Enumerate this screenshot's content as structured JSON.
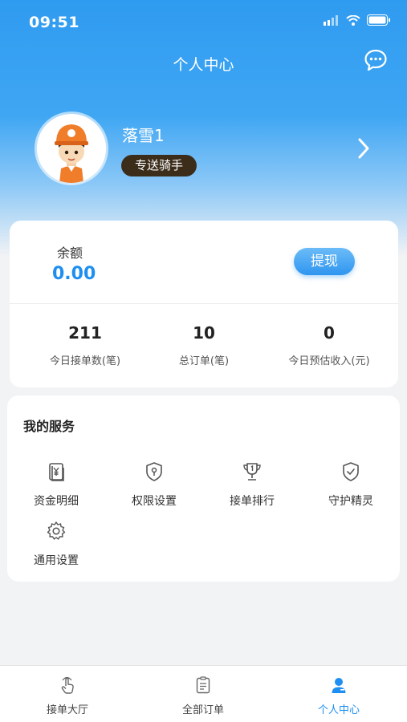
{
  "status_bar": {
    "time": "09:51"
  },
  "header": {
    "title": "个人中心",
    "message_icon": "chat-bubble-icon"
  },
  "profile": {
    "name": "落雪1",
    "role": "专送骑手",
    "avatar": "rider-avatar-icon"
  },
  "balance": {
    "label": "余额",
    "value": "0.00",
    "withdraw_label": "提现"
  },
  "stats": [
    {
      "value": "211",
      "label": "今日接单数(笔)"
    },
    {
      "value": "10",
      "label": "总订单(笔)"
    },
    {
      "value": "0",
      "label": "今日预估收入(元)"
    }
  ],
  "services": {
    "title": "我的服务",
    "items": [
      {
        "label": "资金明细",
        "icon": "money-detail-icon"
      },
      {
        "label": "权限设置",
        "icon": "permission-shield-icon"
      },
      {
        "label": "接单排行",
        "icon": "trophy-icon"
      },
      {
        "label": "守护精灵",
        "icon": "guard-shield-icon"
      },
      {
        "label": "通用设置",
        "icon": "gear-icon"
      }
    ]
  },
  "tabbar": {
    "items": [
      {
        "label": "接单大厅",
        "icon": "hand-tap-icon"
      },
      {
        "label": "全部订单",
        "icon": "clipboard-icon"
      },
      {
        "label": "个人中心",
        "icon": "person-icon"
      }
    ],
    "active_index": 2
  },
  "colors": {
    "primary": "#1e8ff1",
    "badge_bg": "#3b2d1a"
  }
}
